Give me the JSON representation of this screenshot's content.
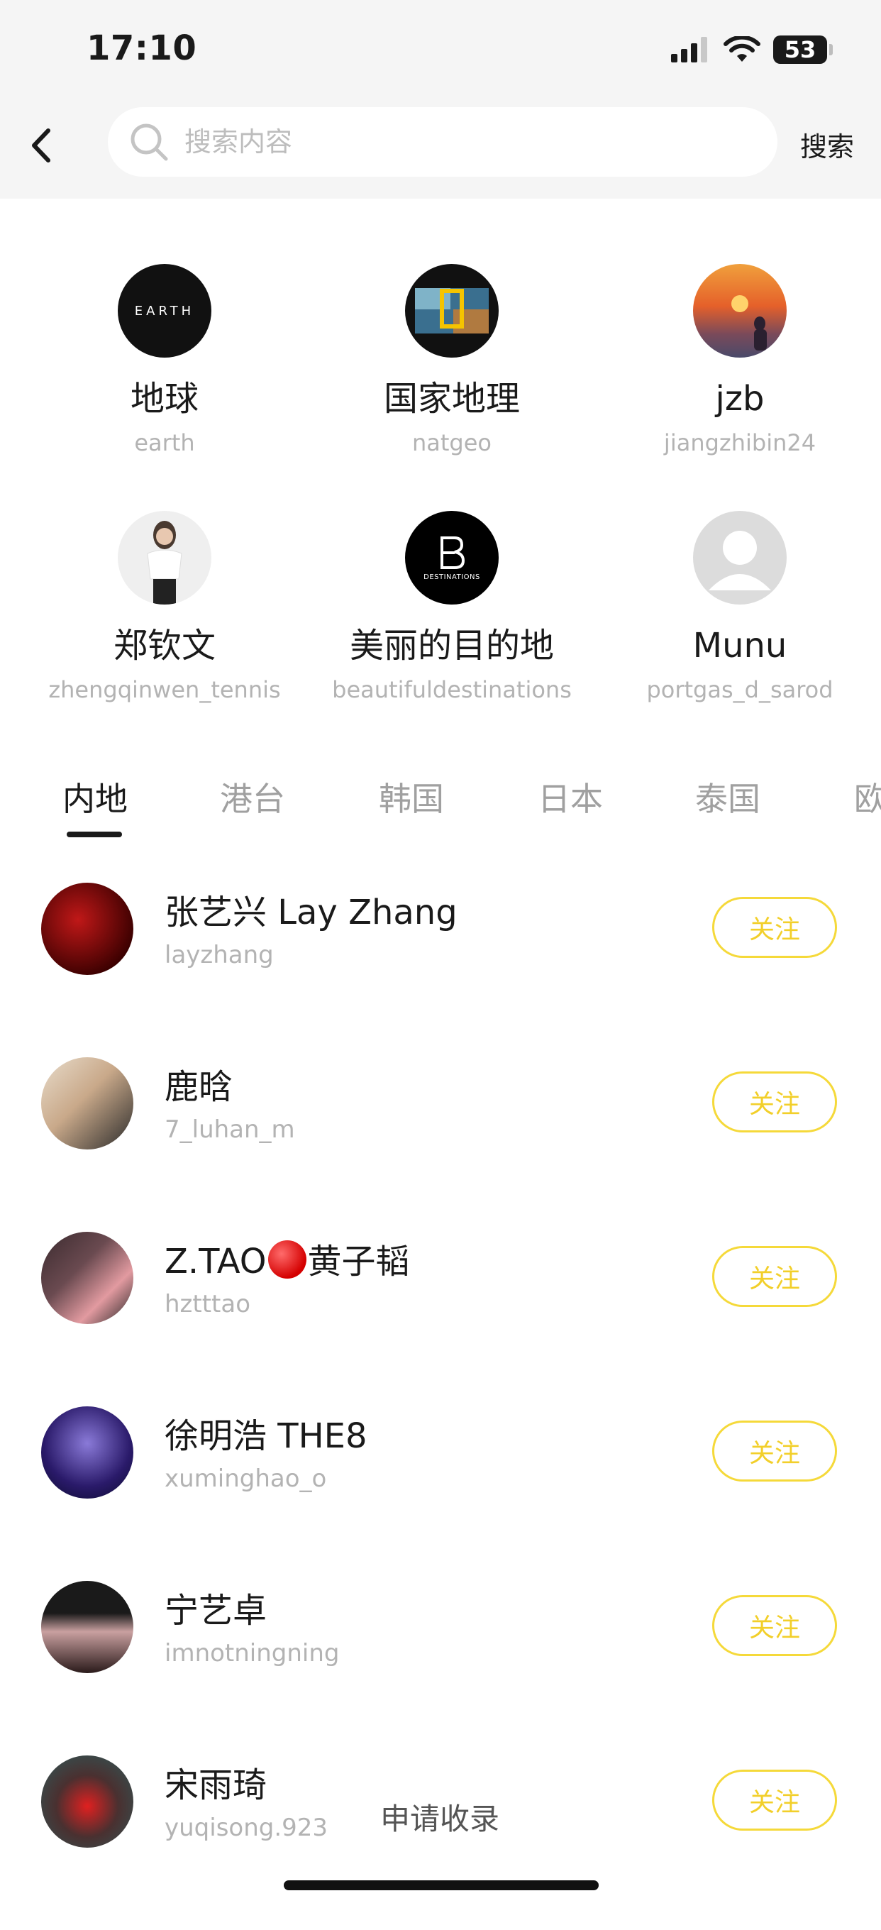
{
  "status_bar": {
    "time": "17:10",
    "battery": "53"
  },
  "search": {
    "placeholder": "搜索内容",
    "button_label": "搜索"
  },
  "featured": [
    {
      "name": "地球",
      "handle": "earth",
      "avatar_text": "EARTH"
    },
    {
      "name": "国家地理",
      "handle": "natgeo"
    },
    {
      "name": "jzb",
      "handle": "jiangzhibin24"
    },
    {
      "name": "郑钦文",
      "handle": "zhengqinwen_tennis"
    },
    {
      "name": "美丽的目的地",
      "handle": "beautifuldestinations",
      "avatar_text": "DESTINATIONS"
    },
    {
      "name": "Munu",
      "handle": "portgas_d_sarod"
    }
  ],
  "tabs": [
    "内地",
    "港台",
    "韩国",
    "日本",
    "泰国",
    "欧"
  ],
  "active_tab": "内地",
  "list": [
    {
      "name": "张艺兴 Lay Zhang",
      "handle": "layzhang",
      "follow_label": "关注"
    },
    {
      "name": "鹿晗",
      "handle": "7_luhan_m",
      "follow_label": "关注"
    },
    {
      "name_prefix": "Z.TAO",
      "name_suffix": "黄子韬",
      "handle": "hztttao",
      "follow_label": "关注"
    },
    {
      "name": "徐明浩 THE8",
      "handle": "xuminghao_o",
      "follow_label": "关注"
    },
    {
      "name": "宁艺卓",
      "handle": "imnotningning",
      "follow_label": "关注"
    },
    {
      "name": "宋雨琦",
      "handle": "yuqisong.923",
      "follow_label": "关注"
    }
  ],
  "apply_label": "申请收录",
  "colors": {
    "accent": "#f5d93a",
    "header_bg": "#f5f5f5",
    "muted": "#b3b3b3"
  }
}
